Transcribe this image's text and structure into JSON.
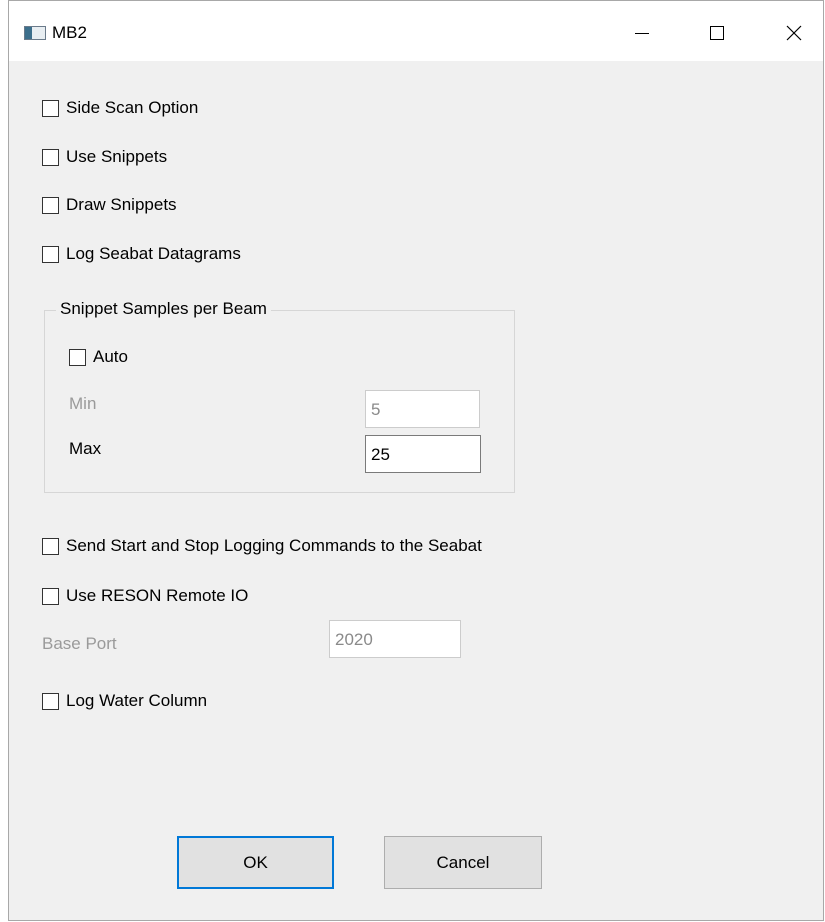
{
  "window": {
    "title": "MB2"
  },
  "checkboxes": {
    "side_scan": {
      "label": "Side Scan Option",
      "checked": false
    },
    "use_snippets": {
      "label": "Use Snippets",
      "checked": false
    },
    "draw_snippets": {
      "label": "Draw Snippets",
      "checked": false
    },
    "log_seabat": {
      "label": "Log Seabat Datagrams",
      "checked": false
    },
    "send_start_stop": {
      "label": "Send Start and Stop Logging Commands to the Seabat",
      "checked": false
    },
    "use_reson": {
      "label": "Use RESON Remote IO",
      "checked": false
    },
    "log_water_column": {
      "label": "Log Water Column",
      "checked": false
    }
  },
  "snippet_group": {
    "title": "Snippet Samples per Beam",
    "auto": {
      "label": "Auto",
      "checked": false
    },
    "min": {
      "label": "Min",
      "value": "5"
    },
    "max": {
      "label": "Max",
      "value": "25"
    }
  },
  "base_port": {
    "label": "Base Port",
    "value": "2020"
  },
  "buttons": {
    "ok": "OK",
    "cancel": "Cancel"
  },
  "icons": {
    "app": "app-window-icon",
    "minimize": "minimize-icon",
    "maximize": "maximize-icon",
    "close": "close-icon"
  },
  "colors": {
    "accent": "#0078d7",
    "dialog_bg": "#f0f0f0",
    "disabled_text": "#9a9a9a"
  }
}
